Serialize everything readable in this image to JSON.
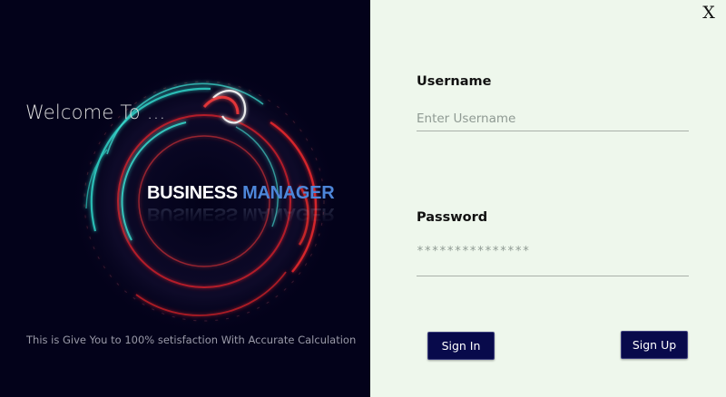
{
  "window": {
    "close_label": "X"
  },
  "left_panel": {
    "welcome_text": "Welcome To ...",
    "logo": {
      "word1": "BUSINESS",
      "word2": "MANAGER"
    },
    "tagline": "This is Give You to 100% setisfaction With Accurate Calculation"
  },
  "form": {
    "username_label": "Username",
    "username_placeholder": "Enter Username",
    "password_label": "Password",
    "password_value": "***************",
    "signin_label": "Sign In",
    "signup_label": "Sign Up"
  },
  "colors": {
    "left_bg": "#03021a",
    "right_bg": "#eef7ec",
    "button_bg": "#080a4b",
    "logo_accent": "#4d86d9"
  }
}
